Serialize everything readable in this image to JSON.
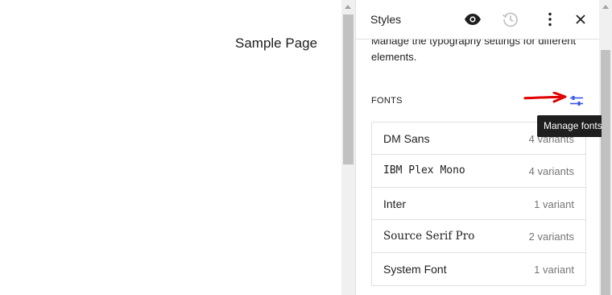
{
  "canvas": {
    "page_title": "Sample Page"
  },
  "sidebar": {
    "title": "Styles",
    "description": "Manage the typography settings for different elements.",
    "fonts_label": "FONTS",
    "tooltip": "Manage fonts",
    "icons": {
      "preview": "eye-icon",
      "revisions": "history-icon",
      "more": "more-vertical-icon",
      "close": "close-icon",
      "manage_fonts": "sliders-icon",
      "annotation": "red-arrow"
    },
    "fonts": [
      {
        "name": "DM Sans",
        "variants": "4 variants"
      },
      {
        "name": "IBM Plex Mono",
        "variants": "4 variants"
      },
      {
        "name": "Inter",
        "variants": "1 variant"
      },
      {
        "name": "Source Serif Pro",
        "variants": "2 variants"
      },
      {
        "name": "System Font",
        "variants": "1 variant"
      }
    ]
  },
  "colors": {
    "accent": "#3858e9",
    "annotation": "#e00000",
    "tooltip_bg": "#1e1e1e"
  }
}
